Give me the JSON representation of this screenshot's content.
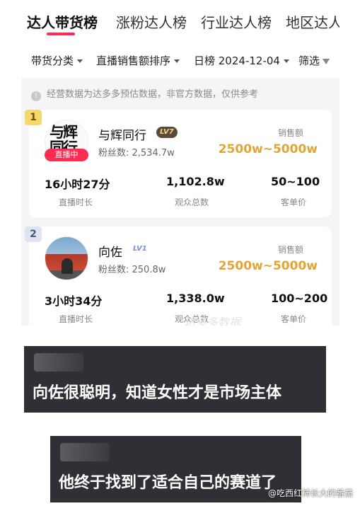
{
  "tabs": [
    {
      "label": "达人带货榜"
    },
    {
      "label": "涨粉达人榜"
    },
    {
      "label": "行业达人榜"
    },
    {
      "label": "地区达人"
    }
  ],
  "filters": {
    "category": "带货分类",
    "sort": "直播销售额排序",
    "date": "日榜 2024-12-04",
    "screen": "筛选"
  },
  "notice": "经营数据为达多多预估数据，非官方数据，仅供参考",
  "ranking": [
    {
      "rank": "1",
      "avatar_text": "与辉同行",
      "live_badge": "直播中",
      "name": "与辉同行",
      "level": "LV7",
      "fans": "粉丝数: 2,534.7w",
      "sales_label": "销售额",
      "sales_value": "2500w~5000w",
      "stats": [
        {
          "value": "16小时27分",
          "label": "直播时长"
        },
        {
          "value": "1,102.8w",
          "label": "观众总数"
        },
        {
          "value": "50~100",
          "label": "客单价"
        }
      ]
    },
    {
      "rank": "2",
      "name": "向佐",
      "level": "LV1",
      "fans": "粉丝数: 250.8w",
      "sales_label": "销售额",
      "sales_value": "2500w~5000w",
      "stats": [
        {
          "value": "3小时34分",
          "label": "直播时长"
        },
        {
          "value": "1,338.0w",
          "label": "观众总数"
        },
        {
          "value": "100~200",
          "label": "客单价"
        }
      ]
    }
  ],
  "watermark": "达多多数据",
  "captions": [
    {
      "text": "向佐很聪明，知道女性才是市场主体"
    },
    {
      "text": "他终于找到了适合自己的赛道了"
    }
  ],
  "weibo_credit": "@吃西红柿长大的番茄",
  "colors": {
    "accent": "#fe2c55",
    "sales": "#e0a533",
    "caption_bg": "#2f2f36"
  }
}
